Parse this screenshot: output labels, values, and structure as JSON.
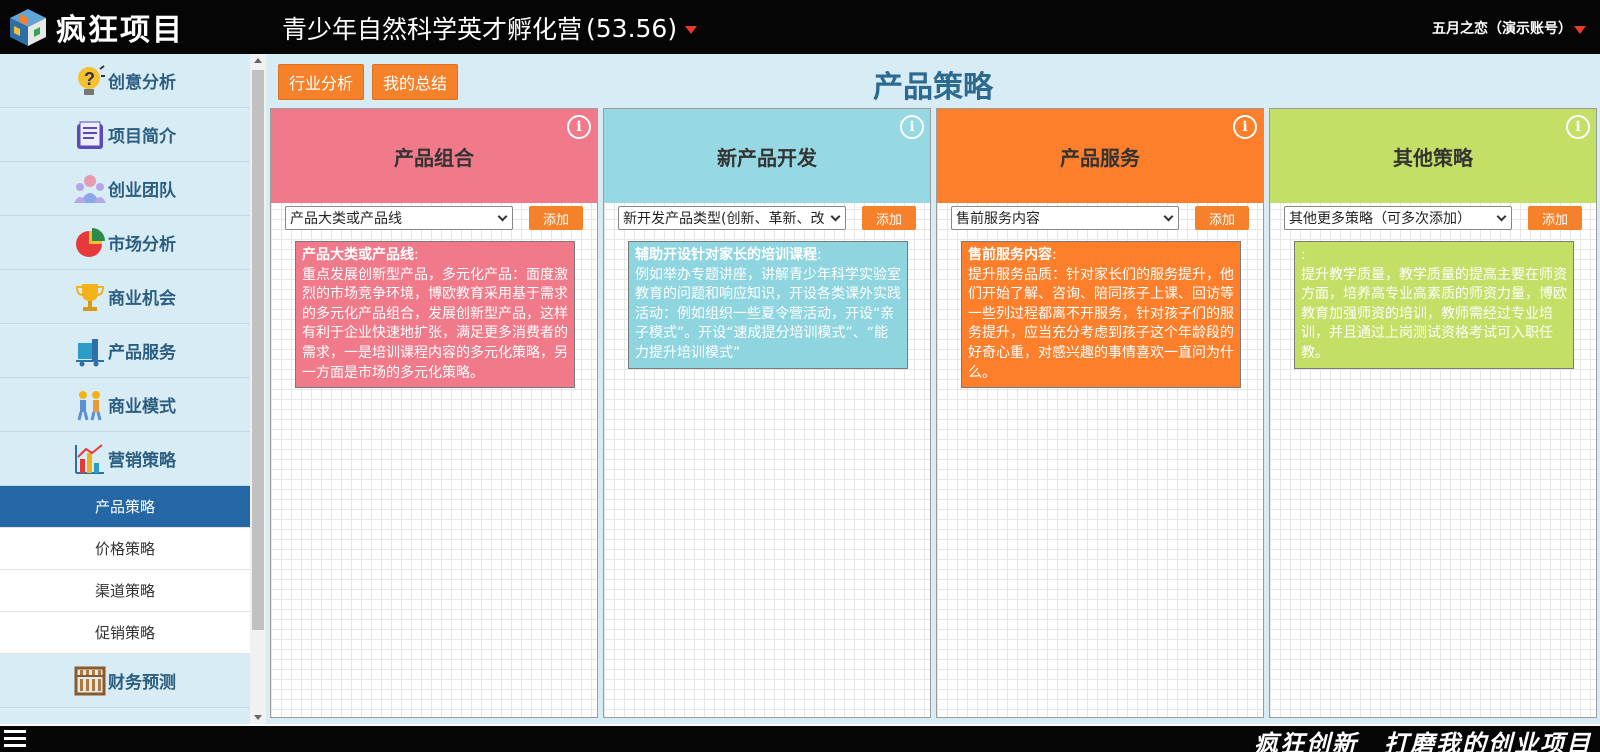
{
  "header": {
    "logo_text": "疯狂项目",
    "project_name": "青少年自然科学英才孵化营",
    "project_score": "(53.56)",
    "user": "五月之恋（演示账号）"
  },
  "sidebar": {
    "items": [
      {
        "label": "创意分析",
        "icon": "idea-question-icon"
      },
      {
        "label": "项目简介",
        "icon": "document-icon"
      },
      {
        "label": "创业团队",
        "icon": "team-icon"
      },
      {
        "label": "市场分析",
        "icon": "pie-chart-icon"
      },
      {
        "label": "商业机会",
        "icon": "trophy-icon"
      },
      {
        "label": "产品服务",
        "icon": "cart-icon"
      },
      {
        "label": "商业模式",
        "icon": "people-icon"
      },
      {
        "label": "营销策略",
        "icon": "bar-chart-icon"
      }
    ],
    "sub_items": [
      "产品策略",
      "价格策略",
      "渠道策略",
      "促销策略"
    ],
    "active_sub": "产品策略",
    "after_items": [
      {
        "label": "财务预测",
        "icon": "abacus-icon"
      }
    ]
  },
  "main": {
    "buttons": [
      "行业分析",
      "我的总结"
    ],
    "title": "产品策略",
    "add_label": "添加",
    "columns": [
      {
        "title": "产品组合",
        "color": "#f07a8a",
        "select": "产品大类或产品线",
        "note_title": "产品大类或产品线",
        "note_body": "重点发展创新型产品，多元化产品：面度激烈的市场竞争环境，博欧教育采用基于需求的多元化产品组合，发展创新型产品，这样有利于企业快速地扩张，满足更多消费者的需求，一是培训课程内容的多元化策略，另一方面是市场的多元化策略。",
        "note_color": "#f07a8a"
      },
      {
        "title": "新产品开发",
        "color": "#97d9e3",
        "select": "新开发产品类型(创新、革新、改",
        "note_title": "辅助开设针对家长的培训课程",
        "note_body": "例如举办专题讲座，讲解青少年科学实验室教育的问题和响应知识，开设各类课外实践活动：例如组织一些夏令营活动，开设“亲子模式”。开设“速成提分培训模式”、“能力提升培训模式”",
        "note_color": "#8fd5e0"
      },
      {
        "title": "产品服务",
        "color": "#fd7f2c",
        "select": "售前服务内容",
        "note_title": "售前服务内容",
        "note_body": "提升服务品质：针对家长们的服务提升，他们开始了解、咨询、陪同孩子上课、回访等一些列过程都离不开服务，针对孩子们的服务提升，应当充分考虑到孩子这个年龄段的好奇心重，对感兴趣的事情喜欢一直问为什么。",
        "note_color": "#fd7f2c"
      },
      {
        "title": "其他策略",
        "color": "#c4df65",
        "select": "其他更多策略（可多次添加）",
        "note_title": "",
        "note_body": "提升教学质量，教学质量的提高主要在师资方面，培养高专业高素质的师资力量，博欧教育加强师资的培训，教师需经过专业培训，并且通过上岗测试资格考试可入职任教。",
        "note_color": "#c4df65"
      }
    ]
  },
  "footer": {
    "slogan": "疯狂创新　打磨我的创业项目"
  }
}
